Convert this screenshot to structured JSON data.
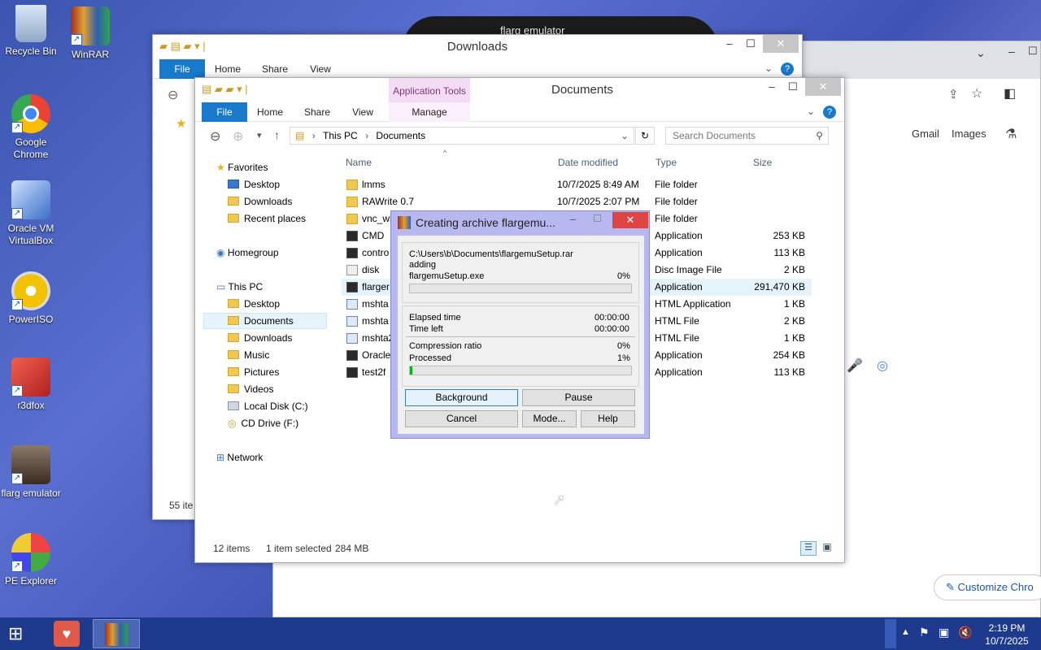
{
  "desktop": {
    "icons": [
      {
        "label": "Recycle Bin",
        "icon": "recycle-bin-icon"
      },
      {
        "label": "WinRAR",
        "icon": "winrar-icon"
      },
      {
        "label": "Google Chrome",
        "icon": "chrome-icon"
      },
      {
        "label": "Oracle VM VirtualBox",
        "icon": "virtualbox-icon"
      },
      {
        "label": "PowerISO",
        "icon": "poweriso-icon"
      },
      {
        "label": "r3dfox",
        "icon": "r3dfox-icon"
      },
      {
        "label": "flarg emulator",
        "icon": "flarg-icon"
      },
      {
        "label": "PE Explorer",
        "icon": "pe-explorer-icon"
      }
    ]
  },
  "phone": {
    "title": "flarg emulator"
  },
  "chrome": {
    "gmail": "Gmail",
    "images": "Images",
    "customize": "Customize Chro"
  },
  "downloads_window": {
    "title": "Downloads",
    "tabs": [
      "File",
      "Home",
      "Share",
      "View"
    ],
    "status": "55 ite"
  },
  "documents_window": {
    "title": "Documents",
    "app_tools": "Application Tools",
    "tabs": [
      "File",
      "Home",
      "Share",
      "View",
      "Manage"
    ],
    "breadcrumb": [
      "This PC",
      "Documents"
    ],
    "search_placeholder": "Search Documents",
    "nav": {
      "favorites": "Favorites",
      "desktop": "Desktop",
      "downloads": "Downloads",
      "recent": "Recent places",
      "homegroup": "Homegroup",
      "thispc": "This PC",
      "pc_desktop": "Desktop",
      "pc_documents": "Documents",
      "pc_downloads": "Downloads",
      "music": "Music",
      "pictures": "Pictures",
      "videos": "Videos",
      "localdisk": "Local Disk (C:)",
      "cddrive": "CD Drive (F:)",
      "network": "Network"
    },
    "columns": {
      "name": "Name",
      "date": "Date modified",
      "type": "Type",
      "size": "Size"
    },
    "files": [
      {
        "name": "lmms",
        "date": "10/7/2025 8:49 AM",
        "type": "File folder",
        "size": ""
      },
      {
        "name": "RAWrite 0.7",
        "date": "10/7/2025 2:07 PM",
        "type": "File folder",
        "size": ""
      },
      {
        "name": "vnc_wi",
        "date": "",
        "type": "File folder",
        "size": ""
      },
      {
        "name": "CMD",
        "date": "",
        "type": "Application",
        "size": "253 KB"
      },
      {
        "name": "contro",
        "date": "",
        "type": "Application",
        "size": "113 KB"
      },
      {
        "name": "disk",
        "date": "",
        "type": "Disc Image File",
        "size": "2 KB"
      },
      {
        "name": "flarger",
        "date": "",
        "type": "Application",
        "size": "291,470 KB"
      },
      {
        "name": "mshta",
        "date": "",
        "type": "HTML Application",
        "size": "1 KB"
      },
      {
        "name": "mshta",
        "date": "",
        "type": "HTML File",
        "size": "2 KB"
      },
      {
        "name": "mshta2",
        "date": "",
        "type": "HTML File",
        "size": "1 KB"
      },
      {
        "name": "Oracle",
        "date": "",
        "type": "Application",
        "size": "254 KB"
      },
      {
        "name": "test2f",
        "date": "",
        "type": "Application",
        "size": "113 KB"
      }
    ],
    "status": {
      "items": "12 items",
      "selected": "1 item selected",
      "size": "284 MB"
    }
  },
  "archive_dialog": {
    "title": "Creating archive flargemu...",
    "path": "C:\\Users\\b\\Documents\\flargemuSetup.rar",
    "action": "adding",
    "file": "flargemuSetup.exe",
    "file_pct": "0%",
    "file_progress": 0,
    "elapsed_label": "Elapsed time",
    "elapsed": "00:00:00",
    "left_label": "Time left",
    "left": "00:00:00",
    "ratio_label": "Compression ratio",
    "ratio": "0%",
    "processed_label": "Processed",
    "processed": "1%",
    "processed_progress": 0.01,
    "buttons": {
      "background": "Background",
      "pause": "Pause",
      "cancel": "Cancel",
      "mode": "Mode...",
      "help": "Help"
    }
  },
  "taskbar": {
    "time": "2:19 PM",
    "date": "10/7/2025"
  }
}
